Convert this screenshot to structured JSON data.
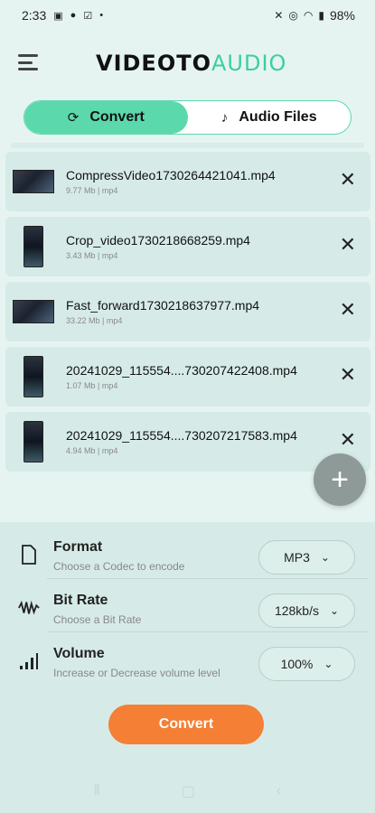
{
  "status": {
    "time": "2:33",
    "battery": "98%"
  },
  "header": {
    "logo_left": "VIDEOTO",
    "logo_right": "AUDIO"
  },
  "tabs": [
    {
      "label": "Convert",
      "icon": "refresh-icon",
      "active": true
    },
    {
      "label": "Audio Files",
      "icon": "music-note-icon",
      "active": false
    }
  ],
  "files": [
    {
      "name": "CompressVideo1730264421041.mp4",
      "meta": "9.77 Mb | mp4",
      "orientation": "landscape"
    },
    {
      "name": "Crop_video1730218668259.mp4",
      "meta": "3.43 Mb | mp4",
      "orientation": "portrait"
    },
    {
      "name": "Fast_forward1730218637977.mp4",
      "meta": "33.22 Mb | mp4",
      "orientation": "landscape"
    },
    {
      "name": "20241029_115554....730207422408.mp4",
      "meta": "1.07 Mb | mp4",
      "orientation": "portrait"
    },
    {
      "name": "20241029_115554....730207217583.mp4",
      "meta": "4.94 Mb | mp4",
      "orientation": "portrait"
    }
  ],
  "settings": {
    "format": {
      "title": "Format",
      "subtitle": "Choose a Codec to encode",
      "value": "MP3"
    },
    "bitrate": {
      "title": "Bit Rate",
      "subtitle": "Choose a Bit Rate",
      "value": "128kb/s"
    },
    "volume": {
      "title": "Volume",
      "subtitle": "Increase or Decrease volume level",
      "value": "100%"
    }
  },
  "convert_button": "Convert",
  "colors": {
    "accent": "#5cd8ad",
    "convert": "#f47f35",
    "background": "#e6f4f1"
  }
}
